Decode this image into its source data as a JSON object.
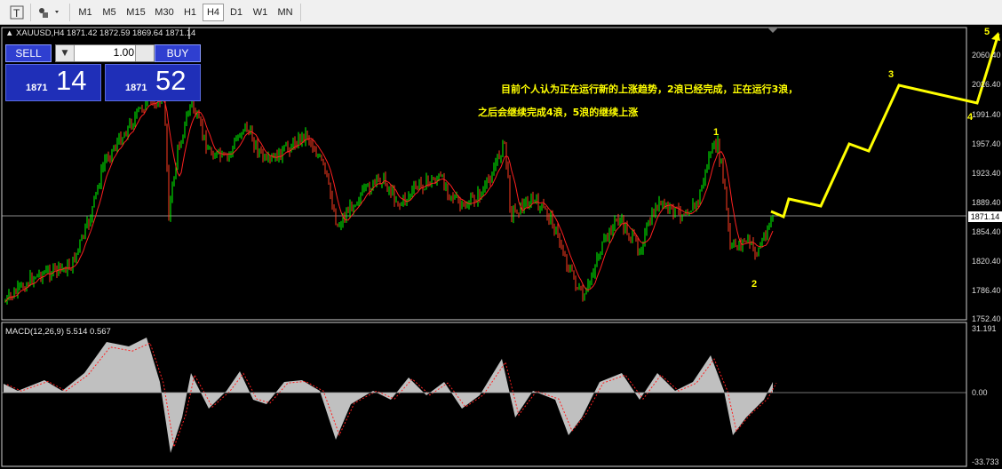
{
  "toolbar": {
    "icons": [
      "text-tool-icon",
      "shapes-tool-icon"
    ],
    "timeframes": [
      "M1",
      "M5",
      "M15",
      "M30",
      "H1",
      "H4",
      "D1",
      "W1",
      "MN"
    ],
    "active_timeframe": "H4"
  },
  "chart": {
    "symbol_line": "XAUUSD,H4  1871.42 1872.59 1869.64 1871.14",
    "current_price": "1871.14",
    "price_axis": [
      "2060.40",
      "2026.40",
      "1991.40",
      "1957.40",
      "1923.40",
      "1889.40",
      "1854.40",
      "1820.40",
      "1786.40",
      "1752.40"
    ],
    "annotation_line1": "目前个人认为正在运行新的上涨趋势，2浪已经完成，正在运行3浪，",
    "annotation_line2": "之后会继续完成4浪，5浪的继续上涨",
    "wave_labels": [
      "1",
      "2",
      "3",
      "4",
      "5"
    ],
    "colors": {
      "bull": "#00ff00",
      "bear": "#ff3b1f",
      "ma": "#ff2020",
      "projection": "#ffff00",
      "macd_fill": "#c0c0c0",
      "signal": "#ff2020"
    }
  },
  "trade_panel": {
    "sell_label": "SELL",
    "buy_label": "BUY",
    "lot_value": "1.00",
    "sell_prefix": "1871",
    "sell_big": "14",
    "buy_prefix": "1871",
    "buy_big": "52"
  },
  "macd": {
    "label": "MACD(12,26,9) 5.514 0.567",
    "axis": [
      "31.191",
      "0.00",
      "-33.733"
    ]
  }
}
